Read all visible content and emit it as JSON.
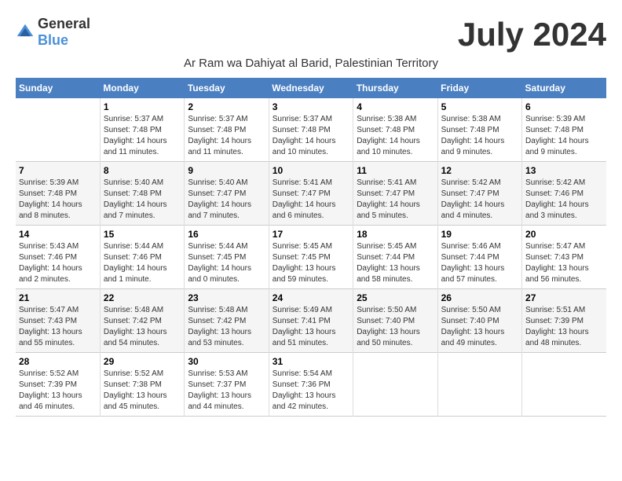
{
  "header": {
    "logo_general": "General",
    "logo_blue": "Blue",
    "month_title": "July 2024",
    "subtitle": "Ar Ram wa Dahiyat al Barid, Palestinian Territory"
  },
  "calendar": {
    "days_of_week": [
      "Sunday",
      "Monday",
      "Tuesday",
      "Wednesday",
      "Thursday",
      "Friday",
      "Saturday"
    ],
    "weeks": [
      [
        {
          "day": "",
          "info": ""
        },
        {
          "day": "1",
          "info": "Sunrise: 5:37 AM\nSunset: 7:48 PM\nDaylight: 14 hours\nand 11 minutes."
        },
        {
          "day": "2",
          "info": "Sunrise: 5:37 AM\nSunset: 7:48 PM\nDaylight: 14 hours\nand 11 minutes."
        },
        {
          "day": "3",
          "info": "Sunrise: 5:37 AM\nSunset: 7:48 PM\nDaylight: 14 hours\nand 10 minutes."
        },
        {
          "day": "4",
          "info": "Sunrise: 5:38 AM\nSunset: 7:48 PM\nDaylight: 14 hours\nand 10 minutes."
        },
        {
          "day": "5",
          "info": "Sunrise: 5:38 AM\nSunset: 7:48 PM\nDaylight: 14 hours\nand 9 minutes."
        },
        {
          "day": "6",
          "info": "Sunrise: 5:39 AM\nSunset: 7:48 PM\nDaylight: 14 hours\nand 9 minutes."
        }
      ],
      [
        {
          "day": "7",
          "info": "Sunrise: 5:39 AM\nSunset: 7:48 PM\nDaylight: 14 hours\nand 8 minutes."
        },
        {
          "day": "8",
          "info": "Sunrise: 5:40 AM\nSunset: 7:48 PM\nDaylight: 14 hours\nand 7 minutes."
        },
        {
          "day": "9",
          "info": "Sunrise: 5:40 AM\nSunset: 7:47 PM\nDaylight: 14 hours\nand 7 minutes."
        },
        {
          "day": "10",
          "info": "Sunrise: 5:41 AM\nSunset: 7:47 PM\nDaylight: 14 hours\nand 6 minutes."
        },
        {
          "day": "11",
          "info": "Sunrise: 5:41 AM\nSunset: 7:47 PM\nDaylight: 14 hours\nand 5 minutes."
        },
        {
          "day": "12",
          "info": "Sunrise: 5:42 AM\nSunset: 7:47 PM\nDaylight: 14 hours\nand 4 minutes."
        },
        {
          "day": "13",
          "info": "Sunrise: 5:42 AM\nSunset: 7:46 PM\nDaylight: 14 hours\nand 3 minutes."
        }
      ],
      [
        {
          "day": "14",
          "info": "Sunrise: 5:43 AM\nSunset: 7:46 PM\nDaylight: 14 hours\nand 2 minutes."
        },
        {
          "day": "15",
          "info": "Sunrise: 5:44 AM\nSunset: 7:46 PM\nDaylight: 14 hours\nand 1 minute."
        },
        {
          "day": "16",
          "info": "Sunrise: 5:44 AM\nSunset: 7:45 PM\nDaylight: 14 hours\nand 0 minutes."
        },
        {
          "day": "17",
          "info": "Sunrise: 5:45 AM\nSunset: 7:45 PM\nDaylight: 13 hours\nand 59 minutes."
        },
        {
          "day": "18",
          "info": "Sunrise: 5:45 AM\nSunset: 7:44 PM\nDaylight: 13 hours\nand 58 minutes."
        },
        {
          "day": "19",
          "info": "Sunrise: 5:46 AM\nSunset: 7:44 PM\nDaylight: 13 hours\nand 57 minutes."
        },
        {
          "day": "20",
          "info": "Sunrise: 5:47 AM\nSunset: 7:43 PM\nDaylight: 13 hours\nand 56 minutes."
        }
      ],
      [
        {
          "day": "21",
          "info": "Sunrise: 5:47 AM\nSunset: 7:43 PM\nDaylight: 13 hours\nand 55 minutes."
        },
        {
          "day": "22",
          "info": "Sunrise: 5:48 AM\nSunset: 7:42 PM\nDaylight: 13 hours\nand 54 minutes."
        },
        {
          "day": "23",
          "info": "Sunrise: 5:48 AM\nSunset: 7:42 PM\nDaylight: 13 hours\nand 53 minutes."
        },
        {
          "day": "24",
          "info": "Sunrise: 5:49 AM\nSunset: 7:41 PM\nDaylight: 13 hours\nand 51 minutes."
        },
        {
          "day": "25",
          "info": "Sunrise: 5:50 AM\nSunset: 7:40 PM\nDaylight: 13 hours\nand 50 minutes."
        },
        {
          "day": "26",
          "info": "Sunrise: 5:50 AM\nSunset: 7:40 PM\nDaylight: 13 hours\nand 49 minutes."
        },
        {
          "day": "27",
          "info": "Sunrise: 5:51 AM\nSunset: 7:39 PM\nDaylight: 13 hours\nand 48 minutes."
        }
      ],
      [
        {
          "day": "28",
          "info": "Sunrise: 5:52 AM\nSunset: 7:39 PM\nDaylight: 13 hours\nand 46 minutes."
        },
        {
          "day": "29",
          "info": "Sunrise: 5:52 AM\nSunset: 7:38 PM\nDaylight: 13 hours\nand 45 minutes."
        },
        {
          "day": "30",
          "info": "Sunrise: 5:53 AM\nSunset: 7:37 PM\nDaylight: 13 hours\nand 44 minutes."
        },
        {
          "day": "31",
          "info": "Sunrise: 5:54 AM\nSunset: 7:36 PM\nDaylight: 13 hours\nand 42 minutes."
        },
        {
          "day": "",
          "info": ""
        },
        {
          "day": "",
          "info": ""
        },
        {
          "day": "",
          "info": ""
        }
      ]
    ]
  }
}
